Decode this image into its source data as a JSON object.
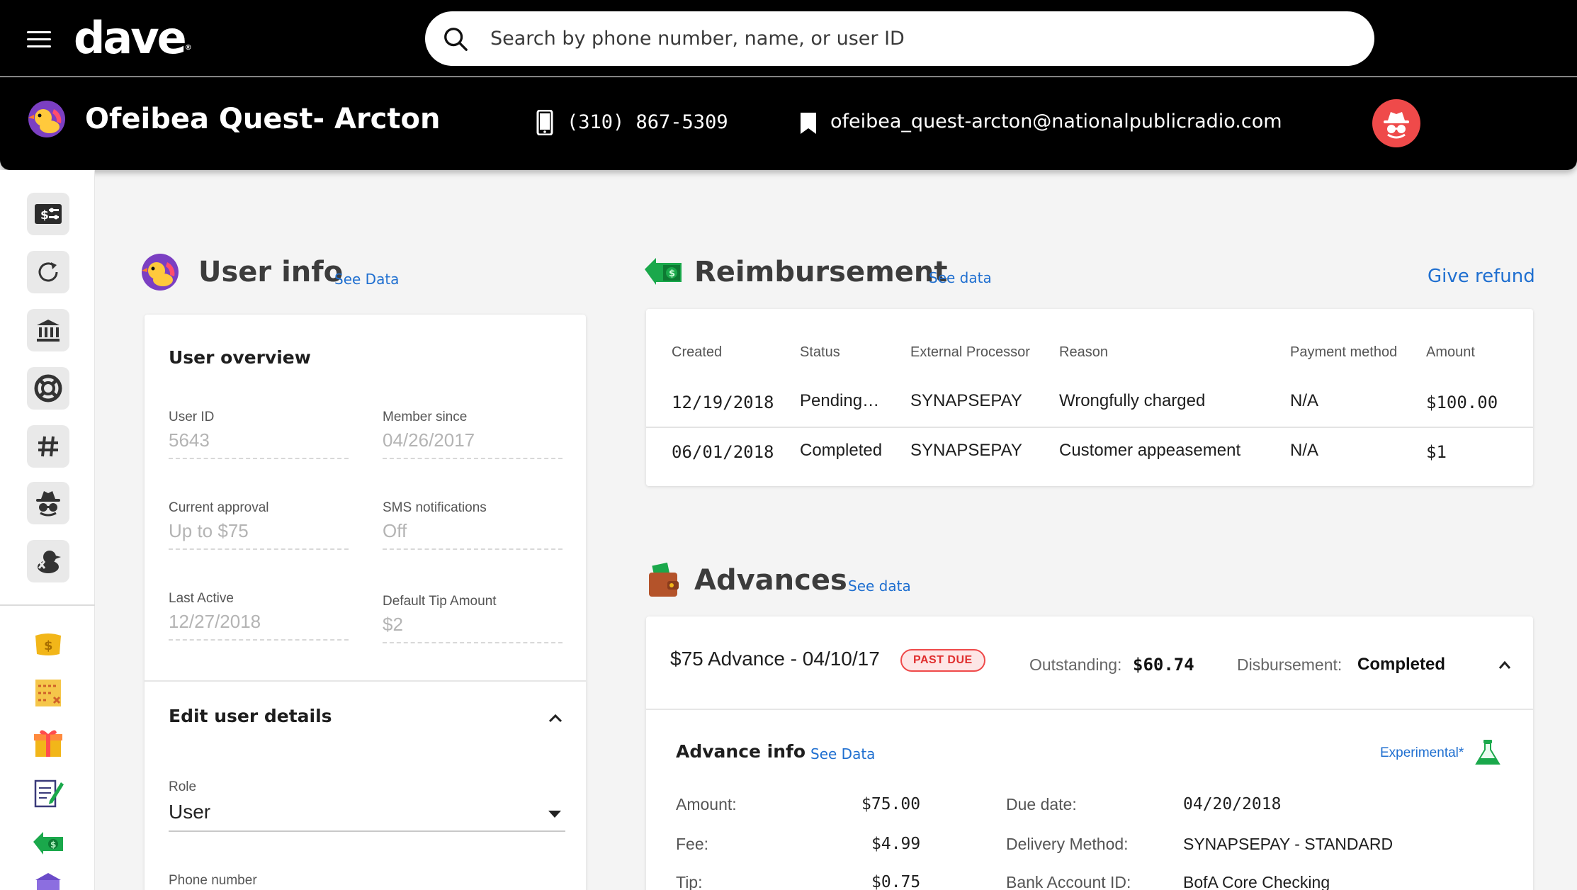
{
  "app": {
    "brand": "Dave",
    "search_placeholder": "Search by phone number, name, or user ID"
  },
  "user_header": {
    "name": "Ofeibea Quest- Arcton",
    "phone": "(310) 867-5309",
    "email": "ofeibea_quest-arcton@nationalpublicradio.com"
  },
  "sidebar": {
    "items": [
      {
        "icon": "money-settings-icon"
      },
      {
        "icon": "refresh-icon"
      },
      {
        "icon": "bank-icon"
      },
      {
        "icon": "lifebuoy-icon"
      },
      {
        "icon": "hashtag-icon"
      },
      {
        "icon": "incognito-icon"
      },
      {
        "icon": "duck-icon"
      },
      {
        "icon": "money-bag-icon"
      },
      {
        "icon": "receipt-icon"
      },
      {
        "icon": "gift-icon"
      },
      {
        "icon": "notepad-icon"
      },
      {
        "icon": "money-back-icon"
      },
      {
        "icon": "bank-purple-icon"
      }
    ]
  },
  "user_info": {
    "title": "User info",
    "see_data": "See Data",
    "overview_title": "User overview",
    "fields": [
      {
        "label": "User ID",
        "value": "5643"
      },
      {
        "label": "Member since",
        "value": "04/26/2017"
      },
      {
        "label": "Current approval",
        "value": "Up to $75"
      },
      {
        "label": "SMS notifications",
        "value": "Off"
      },
      {
        "label": "Last Active",
        "value": "12/27/2018"
      },
      {
        "label": "Default Tip Amount",
        "value": "$2"
      }
    ],
    "edit_title": "Edit user details",
    "role_label": "Role",
    "role_value": "User",
    "phone_label": "Phone number"
  },
  "reimbursement": {
    "title": "Reimbursement",
    "see_data": "See data",
    "give_refund": "Give refund",
    "columns": [
      "Created",
      "Status",
      "External Processor",
      "Reason",
      "Payment method",
      "Amount"
    ],
    "rows": [
      [
        "12/19/2018",
        "Pending…",
        "SYNAPSEPAY",
        "Wrongfully charged",
        "N/A",
        "$100.00"
      ],
      [
        "06/01/2018",
        "Completed",
        "SYNAPSEPAY",
        "Customer appeasement",
        "N/A",
        "$1"
      ]
    ]
  },
  "advances": {
    "title": "Advances",
    "see_data": "See data",
    "advance_title": "$75 Advance - 04/10/17",
    "badge": "PAST DUE",
    "outstanding_label": "Outstanding:",
    "outstanding_value": "$60.74",
    "disbursement_label": "Disbursement:",
    "disbursement_value": "Completed",
    "info_title": "Advance info",
    "info_see_data": "See Data",
    "experimental": "Experimental*",
    "info_left": [
      {
        "label": "Amount:",
        "value": "$75.00"
      },
      {
        "label": "Fee:",
        "value": "$4.99"
      },
      {
        "label": "Tip:",
        "value": "$0.75"
      }
    ],
    "info_right": [
      {
        "label": "Due date:",
        "value": "04/20/2018"
      },
      {
        "label": "Delivery Method:",
        "value": "SYNAPSEPAY - STANDARD"
      },
      {
        "label": "Bank Account ID:",
        "value": "BofA Core Checking"
      }
    ]
  },
  "colors": {
    "accent_blue": "#1f6fd0",
    "alert_red": "#ef4a4a",
    "header_black": "#000000",
    "page_bg": "#f4f4f4"
  }
}
